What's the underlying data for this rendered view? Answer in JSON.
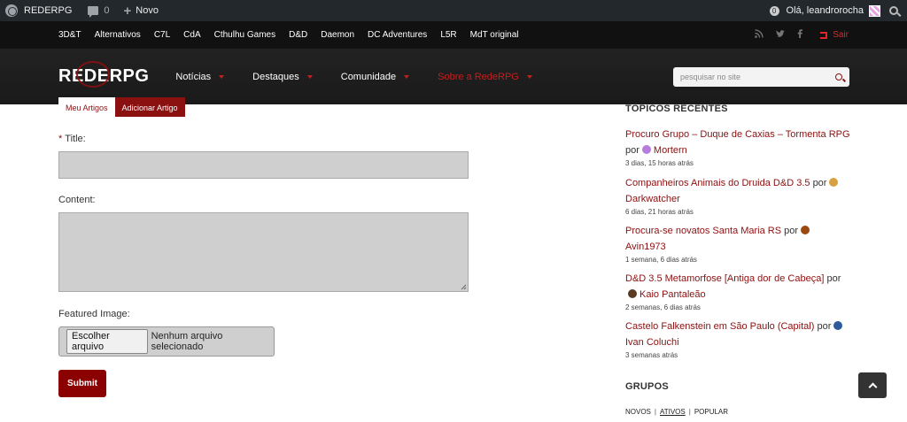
{
  "adminbar": {
    "site_name": "REDERPG",
    "comments_count": "0",
    "new_label": "Novo",
    "notifications": "0",
    "greeting": "Olá, leandrorocha"
  },
  "topnav": {
    "categories": [
      "3D&T",
      "Alternativos",
      "C7L",
      "CdA",
      "Cthulhu Games",
      "D&D",
      "Daemon",
      "DC Adventures",
      "L5R",
      "MdT original"
    ],
    "social_icons": [
      "rss-icon",
      "twitter-icon",
      "facebook-icon"
    ],
    "logout_label": "Sair"
  },
  "header": {
    "logo": "REDERPG",
    "nav": [
      {
        "label": "Notícias",
        "active": false
      },
      {
        "label": "Destaques",
        "active": false
      },
      {
        "label": "Comunidade",
        "active": false
      },
      {
        "label": "Sobre a RedeRPG",
        "active": true
      }
    ],
    "search_placeholder": "pesquisar no site"
  },
  "tabs": {
    "my_articles": "Meu Artigos",
    "add_article": "Adicionar Artigo"
  },
  "form": {
    "title_required_mark": "*",
    "title_label": "Title:",
    "content_label": "Content:",
    "featured_label": "Featured Image:",
    "file_button": "Escolher arquivo",
    "file_status": "Nenhum arquivo selecionado",
    "submit_label": "Submit"
  },
  "sidebar": {
    "recent_title": "TÓPICOS RECENTES",
    "by_word": "por",
    "topics": [
      {
        "title": "Procuro Grupo – Duque de Caxias – Tormenta RPG",
        "author": "Mortern",
        "when": "3 dias, 15 horas atrás",
        "avatar_color": "#b57edc"
      },
      {
        "title": "Companheiros Animais do Druida D&D 3.5",
        "author": "Darkwatcher",
        "when": "6 dias, 21 horas atrás",
        "avatar_color": "#d8a040"
      },
      {
        "title": "Procura-se novatos Santa Maria RS",
        "author": "Avin1973",
        "when": "1 semana, 6 dias atrás",
        "avatar_color": "#9a4a10"
      },
      {
        "title": "D&D 3.5 Metamorfose [Antiga dor de Cabeça]",
        "author": "Kaio Pantaleão",
        "when": "2 semanas, 6 dias atrás",
        "avatar_color": "#5a3a20"
      },
      {
        "title": "Castelo Falkenstein em São Paulo (Capital)",
        "author": "Ivan Coluchi",
        "when": "3 semanas atrás",
        "avatar_color": "#2e5c9a"
      }
    ],
    "groups_title": "GRUPOS",
    "groups_filters": [
      "NOVOS",
      "ATIVOS",
      "POPULAR"
    ]
  },
  "back_to_top_icon": "chevron-up-icon"
}
